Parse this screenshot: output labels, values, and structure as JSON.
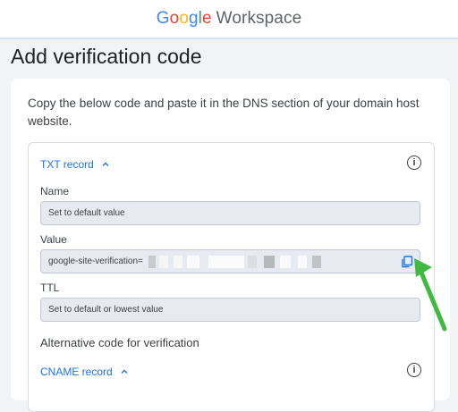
{
  "header": {
    "brand_letters": [
      "G",
      "o",
      "o",
      "g",
      "l",
      "e"
    ],
    "brand_suffix": "Workspace"
  },
  "page_title": "Add verification code",
  "intro": "Copy the below code and paste it in the DNS section of your domain host website.",
  "txt_panel": {
    "title": "TXT record",
    "name_label": "Name",
    "name_value": "Set to default value",
    "value_label": "Value",
    "value_prefix": "google-site-verification=",
    "ttl_label": "TTL",
    "ttl_value": "Set to default or lowest value"
  },
  "alt_heading": "Alternative code for verification",
  "cname_panel": {
    "title": "CNAME record"
  },
  "colors": {
    "accent": "#1a73e8",
    "arrow": "#3fb93f",
    "field_bg": "#e8eaf2"
  },
  "icons": [
    "chevron-up-icon",
    "info-icon",
    "copy-icon",
    "arrow-annotation"
  ]
}
